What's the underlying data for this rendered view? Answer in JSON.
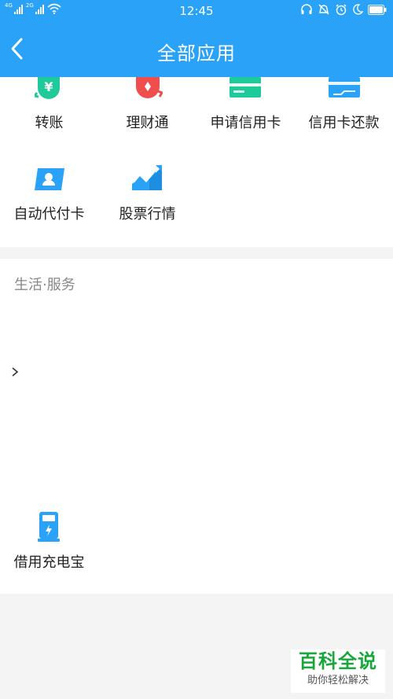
{
  "status": {
    "time": "12:45",
    "net1": "4G",
    "net2": "2G"
  },
  "header": {
    "title": "全部应用"
  },
  "finance_apps": [
    {
      "label": "转账",
      "icon": "transfer-yuan-icon"
    },
    {
      "label": "理财通",
      "icon": "wealth-icon"
    },
    {
      "label": "申请信用卡",
      "icon": "credit-card-apply-icon"
    },
    {
      "label": "信用卡还款",
      "icon": "credit-card-repay-icon"
    },
    {
      "label": "自动代付卡",
      "icon": "auto-pay-card-icon"
    },
    {
      "label": "股票行情",
      "icon": "stock-chart-icon"
    }
  ],
  "life_section": {
    "title": "生活·服务",
    "apps": [
      {
        "label": "借用充电宝",
        "icon": "power-bank-icon"
      }
    ]
  },
  "watermark": {
    "top": "百科全说",
    "bottom": "助你轻松解决"
  },
  "colors": {
    "header": "#2aa2f7",
    "green": "#1ec99a",
    "blue": "#2aa2f7",
    "red": "#f04d4d"
  }
}
